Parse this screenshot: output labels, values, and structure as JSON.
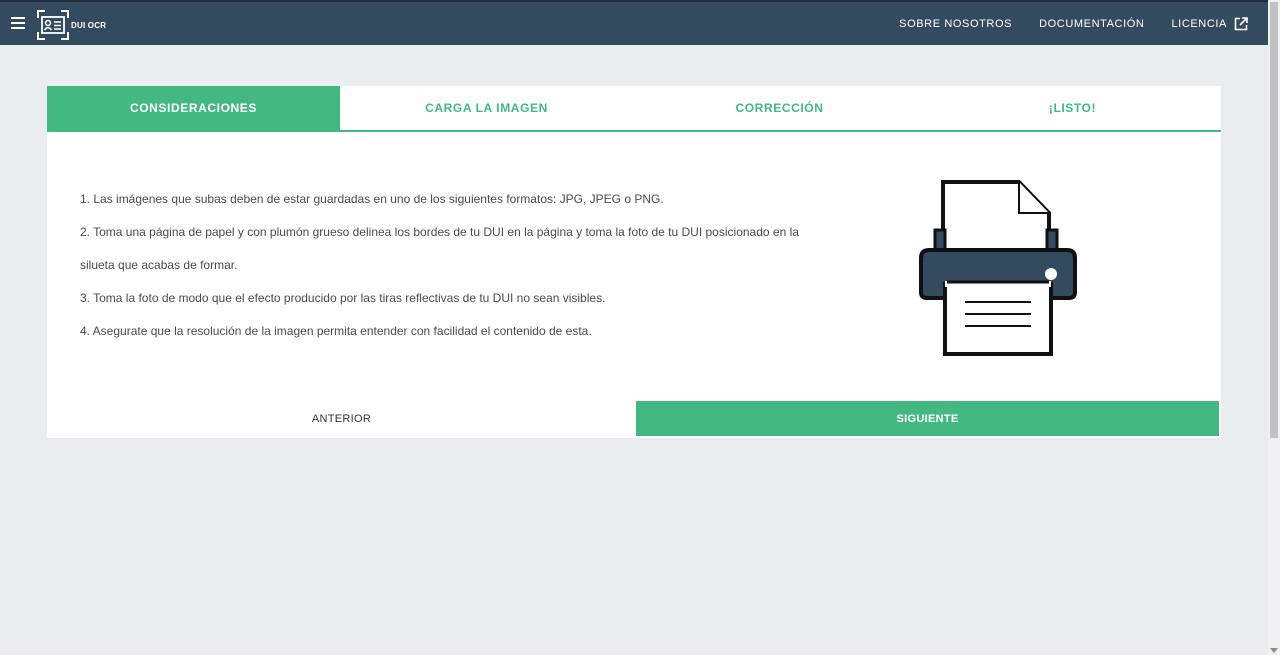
{
  "app": {
    "logo_text": "DUI OCR"
  },
  "nav": {
    "items": [
      {
        "label": "SOBRE NOSOTROS"
      },
      {
        "label": "DOCUMENTACIÓN"
      },
      {
        "label": "LICENCIA"
      }
    ]
  },
  "tabs": [
    {
      "label": "CONSIDERACIONES",
      "active": true
    },
    {
      "label": "CARGA LA IMAGEN",
      "active": false
    },
    {
      "label": "CORRECCIÓN",
      "active": false
    },
    {
      "label": "¡LISTO!",
      "active": false
    }
  ],
  "content": {
    "instructions": [
      "1. Las imágenes que subas deben de estar guardadas en uno de los siguientes formatos: JPG, JPEG o PNG.",
      "2. Toma una página de papel y con plumón grueso delinea los bordes de tu DUI en la página y toma la foto de tu DUI posicionado en la",
      "silueta que acabas de formar.",
      "3. Toma la foto de modo que el efecto producido por las tiras reflectivas de tu DUI no sean visibles.",
      "4. Asegurate que la resolución de la imagen permita entender con facilidad el contenido de esta."
    ]
  },
  "buttons": {
    "prev_label": "ANTERIOR",
    "next_label": "SIGUIENTE"
  },
  "colors": {
    "accent": "#43b883",
    "navbar": "#344a5f",
    "background": "#e9edf0"
  },
  "icons": {
    "menu": "hamburger-icon",
    "logo": "id-card-scan-icon",
    "external": "external-link-icon",
    "illustration": "printer-icon"
  }
}
